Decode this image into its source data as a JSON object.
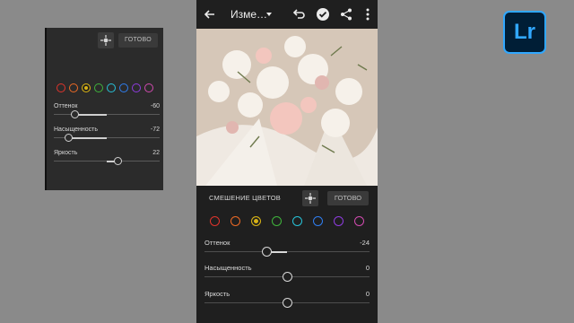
{
  "inset": {
    "done_label": "ГОТОВО",
    "colors": [
      "#e0342c",
      "#ee6a25",
      "#d7b215",
      "#3fb43c",
      "#27c2d8",
      "#2f7ef0",
      "#8f3ce0",
      "#d24bb0"
    ],
    "sliders": [
      {
        "label": "Оттенок",
        "value": "-60",
        "fraction": 0.2
      },
      {
        "label": "Насыщенность",
        "value": "-72",
        "fraction": 0.14
      },
      {
        "label": "Яркость",
        "value": "22",
        "fraction": 0.61
      }
    ]
  },
  "appbar": {
    "title": "Изме…"
  },
  "panel": {
    "label": "СМЕШЕНИЕ ЦВЕТОВ",
    "done_label": "ГОТОВО",
    "colors": [
      "#e0342c",
      "#ee6a25",
      "#d7b215",
      "#3fb43c",
      "#27c2d8",
      "#2f7ef0",
      "#8f3ce0",
      "#d24bb0"
    ],
    "sliders": [
      {
        "label": "Оттенок",
        "value": "-24",
        "fraction": 0.38
      },
      {
        "label": "Насыщенность",
        "value": "0",
        "fraction": 0.5
      },
      {
        "label": "Яркость",
        "value": "0",
        "fraction": 0.5
      }
    ]
  },
  "logo": {
    "text": "Lr",
    "accent": "#31a8ff"
  }
}
